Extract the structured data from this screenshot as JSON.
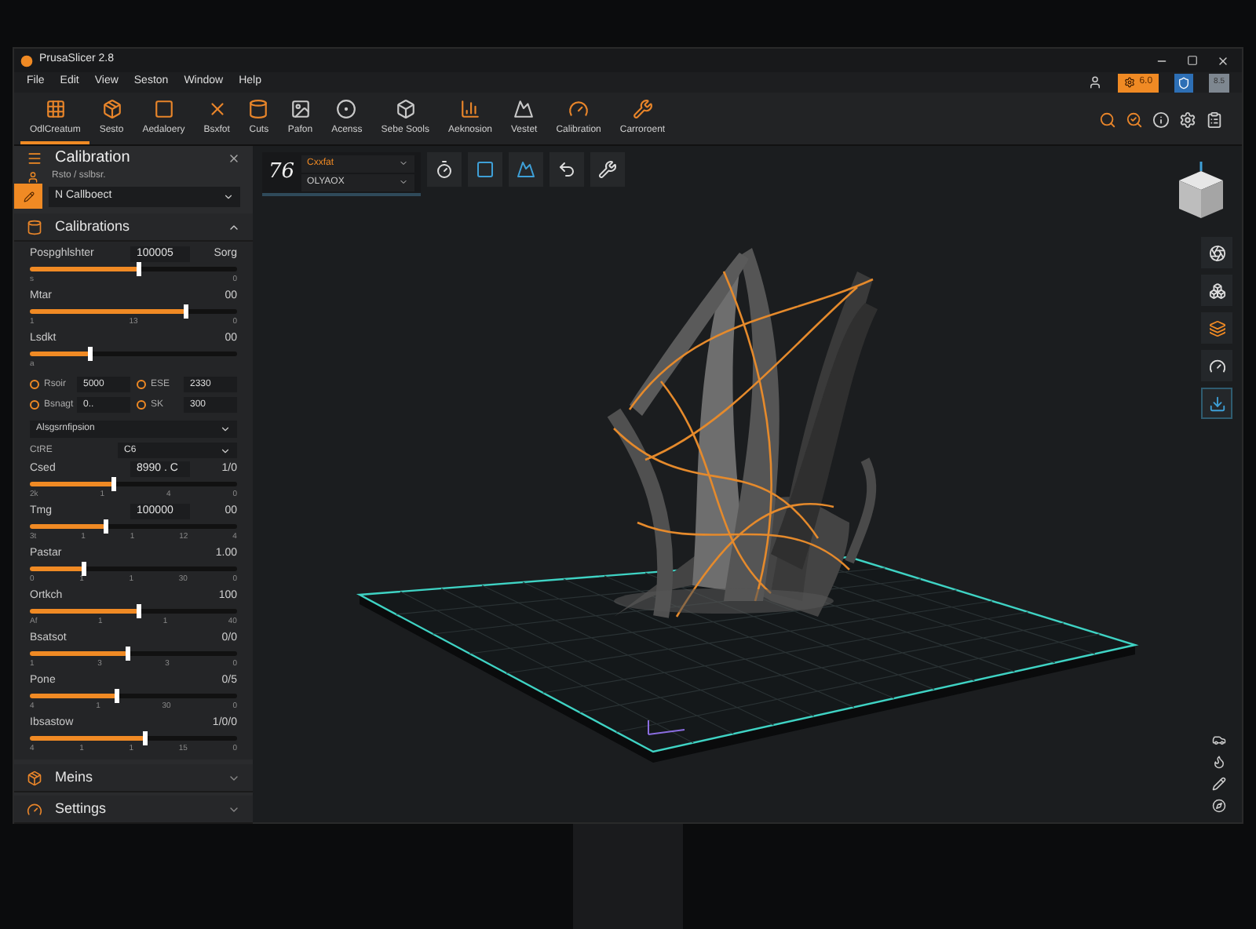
{
  "window": {
    "title": "PrusaSlicer 2.8"
  },
  "menu": [
    "File",
    "Edit",
    "View",
    "Seston",
    "Window",
    "Help"
  ],
  "badges": [
    {
      "label": "6.0",
      "kind": "orange"
    },
    {
      "label": "8.5",
      "kind": "gray"
    }
  ],
  "toolbar": [
    {
      "label": "OdlCreatum",
      "selected": true
    },
    {
      "label": "Sesto",
      "selected": false
    },
    {
      "label": "Aedaloery",
      "selected": false
    },
    {
      "label": "Bsxfot",
      "selected": false
    },
    {
      "label": "Cuts",
      "selected": false
    },
    {
      "label": "Pafon",
      "selected": false
    },
    {
      "label": "Acenss",
      "selected": false
    },
    {
      "label": "Sebe Sools",
      "selected": false
    },
    {
      "label": "Aeknosion",
      "selected": false
    },
    {
      "label": "Vestet",
      "selected": false
    },
    {
      "label": "Calibration",
      "selected": false
    },
    {
      "label": "Carroroent",
      "selected": false
    }
  ],
  "panel": {
    "title": "Calibration",
    "breadcrumb": "Rsto / sslbsr.",
    "profile": "N Callboect",
    "section": {
      "title": "Calibrations",
      "expanded": true
    },
    "sliders_top": [
      {
        "label": "Pospghlshter",
        "field": "100005",
        "value": "Sorg",
        "level": 0.52,
        "ticks": [
          "s",
          "0"
        ]
      },
      {
        "label": "Mtar",
        "value": "00",
        "level": 0.75,
        "ticks": [
          "1",
          "13",
          "0"
        ]
      },
      {
        "label": "Lsdkt",
        "value": "00",
        "level": 0.29,
        "ticks": [
          "a"
        ]
      }
    ],
    "radio_fields": [
      {
        "label": "Rsoir",
        "value": "5000",
        "selected": false
      },
      {
        "label": "ESE",
        "value": "2330",
        "selected": false
      },
      {
        "label": "Bsnagt",
        "value": "0..",
        "selected": false
      },
      {
        "label": "SK",
        "value": "300",
        "selected": false
      }
    ],
    "select": "Alsgsrnfipsion",
    "ctre": {
      "label": "CtRE",
      "value": "C6"
    },
    "sliders": [
      {
        "label": "Csed",
        "field": "8990 . C",
        "value": "1/0",
        "level": 0.4,
        "ticks": [
          "2k",
          "1",
          "4",
          "0"
        ]
      },
      {
        "label": "Tmg",
        "field": "100000",
        "value": "00",
        "level": 0.36,
        "ticks": [
          "3t",
          "1",
          "1",
          "12",
          "4"
        ]
      },
      {
        "label": "Pastar",
        "value": "1.00",
        "level": 0.26,
        "ticks": [
          "0",
          "1",
          "1",
          "30",
          "0"
        ]
      },
      {
        "label": "Ortkch",
        "value": "100",
        "level": 0.52,
        "ticks": [
          "Af",
          "1",
          "1",
          "40"
        ]
      },
      {
        "label": "Bsatsot",
        "value": "0/0",
        "level": 0.47,
        "ticks": [
          "1",
          "3",
          "3",
          "0"
        ]
      },
      {
        "label": "Pone",
        "value": "0/5",
        "level": 0.42,
        "ticks": [
          "4",
          "1",
          "30",
          "0"
        ]
      },
      {
        "label": "Ibsastow",
        "value": "1/0/0",
        "level": 0.55,
        "ticks": [
          "4",
          "1",
          "1",
          "15",
          "0"
        ]
      }
    ],
    "collapsed": [
      {
        "title": "Meins",
        "expanded": false
      },
      {
        "title": "Settings",
        "expanded": false
      }
    ]
  },
  "viewport": {
    "number": "76",
    "preset": "Cxxfat",
    "preset_2": "OLYAOX"
  }
}
